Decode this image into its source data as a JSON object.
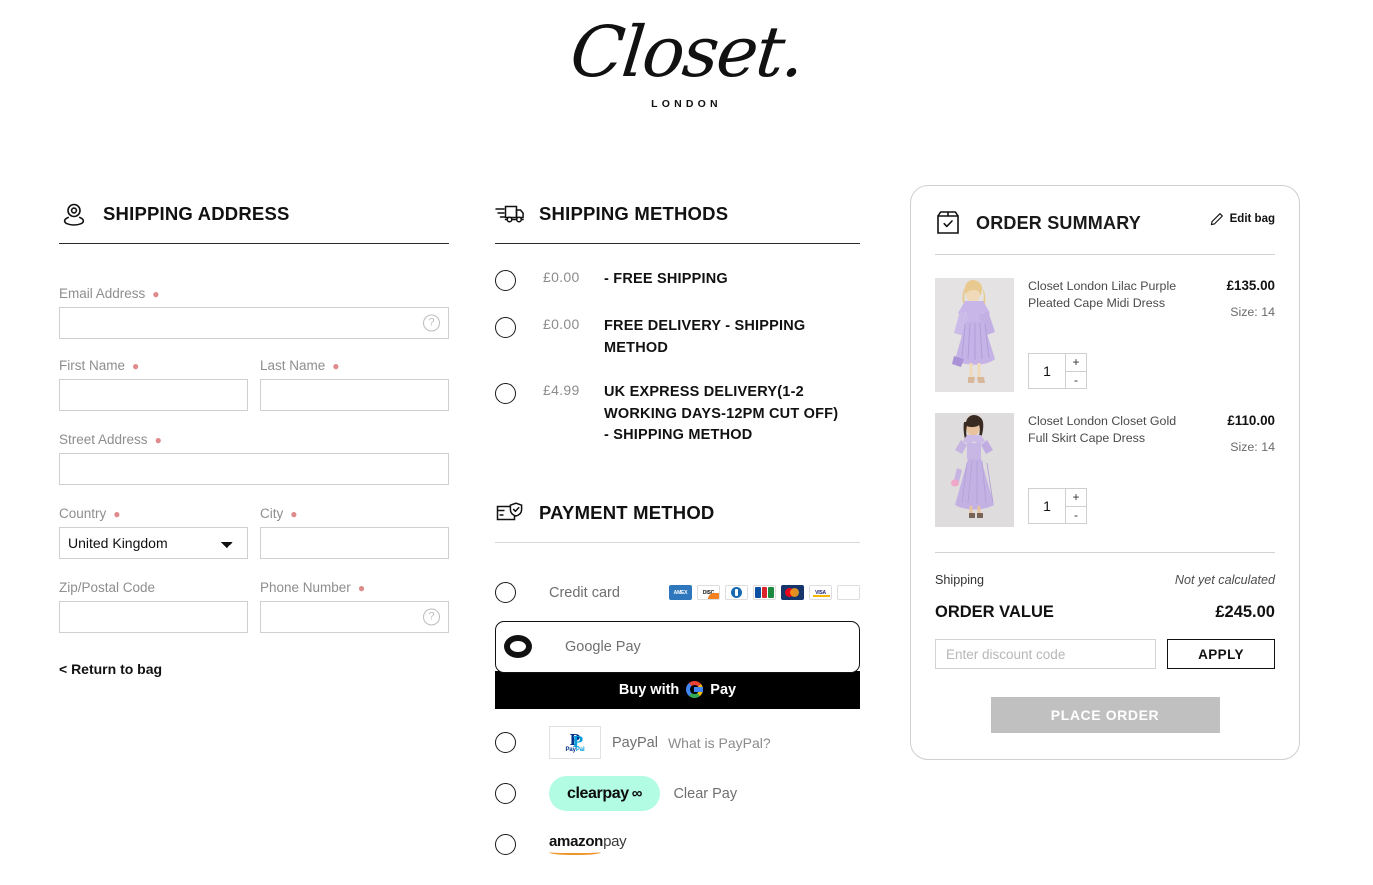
{
  "brand": {
    "name": "Closet.",
    "sub": "LONDON"
  },
  "shipping_address": {
    "title": "SHIPPING ADDRESS",
    "icon": "location-pin-icon",
    "fields": {
      "email": {
        "label": "Email Address",
        "required": true,
        "value": "",
        "placeholder": ""
      },
      "first_name": {
        "label": "First Name",
        "required": true,
        "value": "",
        "placeholder": ""
      },
      "last_name": {
        "label": "Last Name",
        "required": true,
        "value": "",
        "placeholder": ""
      },
      "street": {
        "label": "Street Address",
        "required": true,
        "value": "",
        "placeholder": ""
      },
      "country": {
        "label": "Country",
        "required": true,
        "value": "United Kingdom"
      },
      "city": {
        "label": "City",
        "required": true,
        "value": "",
        "placeholder": ""
      },
      "zip": {
        "label": "Zip/Postal Code",
        "required": false,
        "value": "",
        "placeholder": ""
      },
      "phone": {
        "label": "Phone Number",
        "required": true,
        "value": "",
        "placeholder": ""
      }
    },
    "country_options": [
      "United Kingdom"
    ],
    "return_link": "< Return to bag"
  },
  "shipping_methods": {
    "title": "SHIPPING METHODS",
    "icon": "delivery-truck-icon",
    "options": [
      {
        "price": "£0.00",
        "name": "- FREE SHIPPING",
        "selected": false
      },
      {
        "price": "£0.00",
        "name": "FREE DELIVERY - SHIPPING METHOD",
        "selected": false
      },
      {
        "price": "£4.99",
        "name": "UK EXPRESS DELIVERY(1-2 WORKING DAYS-12PM CUT OFF) - SHIPPING METHOD",
        "selected": false
      }
    ]
  },
  "payment_method": {
    "title": "PAYMENT METHOD",
    "icon": "card-shield-icon",
    "options": [
      {
        "id": "credit-card",
        "label": "Credit card",
        "selected": false
      },
      {
        "id": "google-pay",
        "label": "Google Pay",
        "selected": true
      },
      {
        "id": "paypal",
        "label": "PayPal",
        "note": "What is PayPal?",
        "selected": false
      },
      {
        "id": "clearpay",
        "label": "Clear Pay",
        "logo_text": "clearpay",
        "selected": false
      },
      {
        "id": "amazon-pay",
        "label": "",
        "logo_text_bold": "amazon",
        "logo_text_light": "pay",
        "selected": false
      }
    ],
    "card_brands": [
      "amex",
      "discover",
      "diners",
      "jcb",
      "mastercard",
      "visa",
      "cb"
    ],
    "gpay_button": "Buy with",
    "gpay_button_suffix": "Pay",
    "paypal_logo_top": "P",
    "paypal_logo_bottom": "PayPal"
  },
  "order_summary": {
    "title": "ORDER SUMMARY",
    "icon": "bag-check-icon",
    "edit_bag": "Edit bag",
    "items": [
      {
        "name": "Closet London Lilac Purple Pleated Cape Midi Dress",
        "price": "£135.00",
        "size_label": "Size:",
        "size": "14",
        "qty": "1",
        "plus": "+",
        "minus": "-"
      },
      {
        "name": "Closet London Closet Gold Full Skirt Cape Dress",
        "price": "£110.00",
        "size_label": "Size:",
        "size": "14",
        "qty": "1",
        "plus": "+",
        "minus": "-"
      }
    ],
    "shipping_label": "Shipping",
    "shipping_value": "Not yet calculated",
    "order_value_label": "ORDER VALUE",
    "order_value": "£245.00",
    "discount_placeholder": "Enter discount code",
    "discount_value": "",
    "apply_label": "APPLY",
    "place_order_label": "PLACE ORDER"
  },
  "colors": {
    "accent_black": "#111111",
    "clearpay_mint": "#b2fce4",
    "place_order_disabled": "#c0c0c0",
    "required_asterisk": "#e08b8b"
  }
}
